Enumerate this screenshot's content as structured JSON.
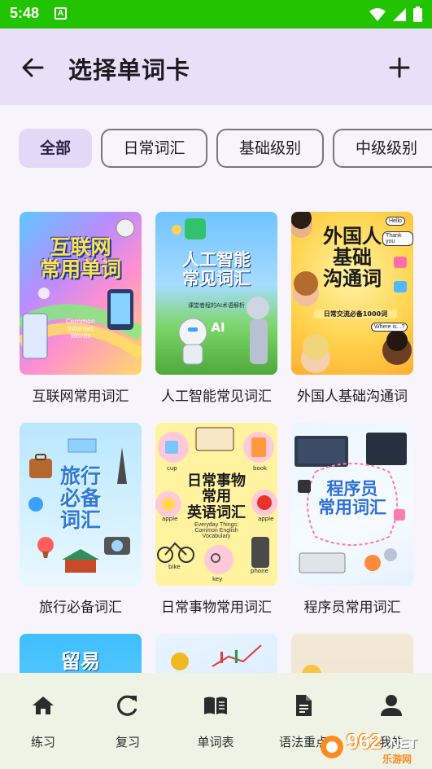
{
  "status": {
    "time": "5:48",
    "notif_letter": "A"
  },
  "header": {
    "title": "选择单词卡"
  },
  "filters": [
    "全部",
    "日常词汇",
    "基础级别",
    "中级级别"
  ],
  "cards": [
    {
      "label": "互联网常用词汇",
      "cover_title": "互联网\n常用单词",
      "cover_sub": "Common\nInternet\nWords"
    },
    {
      "label": "人工智能常见词汇",
      "cover_title": "人工智能\n常见词汇",
      "cover_sub": "课堂者程的AI术语解析",
      "cover_extra": "AI"
    },
    {
      "label": "外国人基础沟通词",
      "cover_title": "外国人\n基础\n沟通词",
      "cover_sub": "日常交流必备1000词",
      "bubbles": [
        "Hello",
        "Thank you",
        "Where is...?"
      ]
    },
    {
      "label": "旅行必备词汇",
      "cover_title": "旅行\n必备\n词汇"
    },
    {
      "label": "日常事物常用词汇",
      "cover_title": "日常事物\n常用\n英语词汇",
      "cover_sub": "Everyday Things:\nCommon English\nVocabulary",
      "tags": [
        "cup",
        "book",
        "apple",
        "apple",
        "bike",
        "key",
        "phone"
      ]
    },
    {
      "label": "程序员常用词汇",
      "cover_title": "程序员\n常用词汇"
    },
    {
      "label": "",
      "cover_title": "留易"
    },
    {
      "label": "",
      "cover_title": ""
    },
    {
      "label": "",
      "cover_title": ""
    }
  ],
  "nav": [
    {
      "label": "练习",
      "icon": "home-icon"
    },
    {
      "label": "复习",
      "icon": "refresh-icon"
    },
    {
      "label": "单词表",
      "icon": "book-icon"
    },
    {
      "label": "语法重点",
      "icon": "document-icon"
    },
    {
      "label": "我的",
      "icon": "person-icon"
    }
  ],
  "watermark": {
    "text": "962",
    "suffix": ".NET",
    "sub": "乐游网"
  },
  "colors": {
    "status_bar": "#22c300",
    "app_bar": "#e9dff8",
    "chip_active": "#e3d9f7",
    "nav_bar": "#eef3e6"
  }
}
